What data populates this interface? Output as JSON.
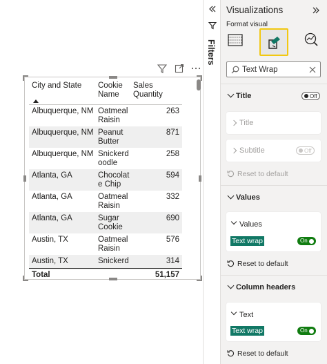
{
  "table": {
    "columns": [
      "City and State",
      "Cookie Name",
      "Sales Quantity"
    ],
    "rows": [
      {
        "city": "Albuquerque, NM",
        "cookie": "Oatmeal Raisin",
        "qty": "263"
      },
      {
        "city": "Albuquerque, NM",
        "cookie": "Peanut Butter",
        "qty": "871"
      },
      {
        "city": "Albuquerque, NM",
        "cookie": "Snickerdoodle",
        "qty": "258"
      },
      {
        "city": "Atlanta, GA",
        "cookie": "Chocolate Chip",
        "qty": "594"
      },
      {
        "city": "Atlanta, GA",
        "cookie": "Oatmeal Raisin",
        "qty": "332"
      },
      {
        "city": "Atlanta, GA",
        "cookie": "Sugar Cookie",
        "qty": "690"
      },
      {
        "city": "Austin, TX",
        "cookie": "Oatmeal Raisin",
        "qty": "576"
      },
      {
        "city": "Austin, TX",
        "cookie": "Snickerd",
        "qty": "314"
      }
    ],
    "total_label": "Total",
    "total_value": "51,157"
  },
  "filters": {
    "label": "Filters"
  },
  "viz": {
    "title": "Visualizations",
    "subtitle": "Format visual",
    "search_value": "Text Wrap",
    "title_section": {
      "label": "Title",
      "toggle": "Off",
      "card_title": "Title",
      "card_subtitle": "Subtitle",
      "subtitle_toggle": "Off",
      "reset": "Reset to default"
    },
    "values_section": {
      "label": "Values",
      "card_title": "Values",
      "option": "Text wrap",
      "toggle": "On",
      "reset": "Reset to default"
    },
    "column_headers_section": {
      "label": "Column headers",
      "card_title": "Text",
      "option": "Text wrap",
      "toggle": "On",
      "reset": "Reset to default"
    }
  },
  "colors": {
    "accent_highlight": "#117865",
    "toggle_on": "#107c10",
    "selected_border": "#f2c811"
  },
  "icons": [
    "filter-icon",
    "focus-mode-icon",
    "more-options-icon",
    "collapse-icon",
    "expand-icon",
    "build-visual-icon",
    "format-visual-icon",
    "analytics-icon",
    "search-icon",
    "clear-icon",
    "reset-icon"
  ]
}
